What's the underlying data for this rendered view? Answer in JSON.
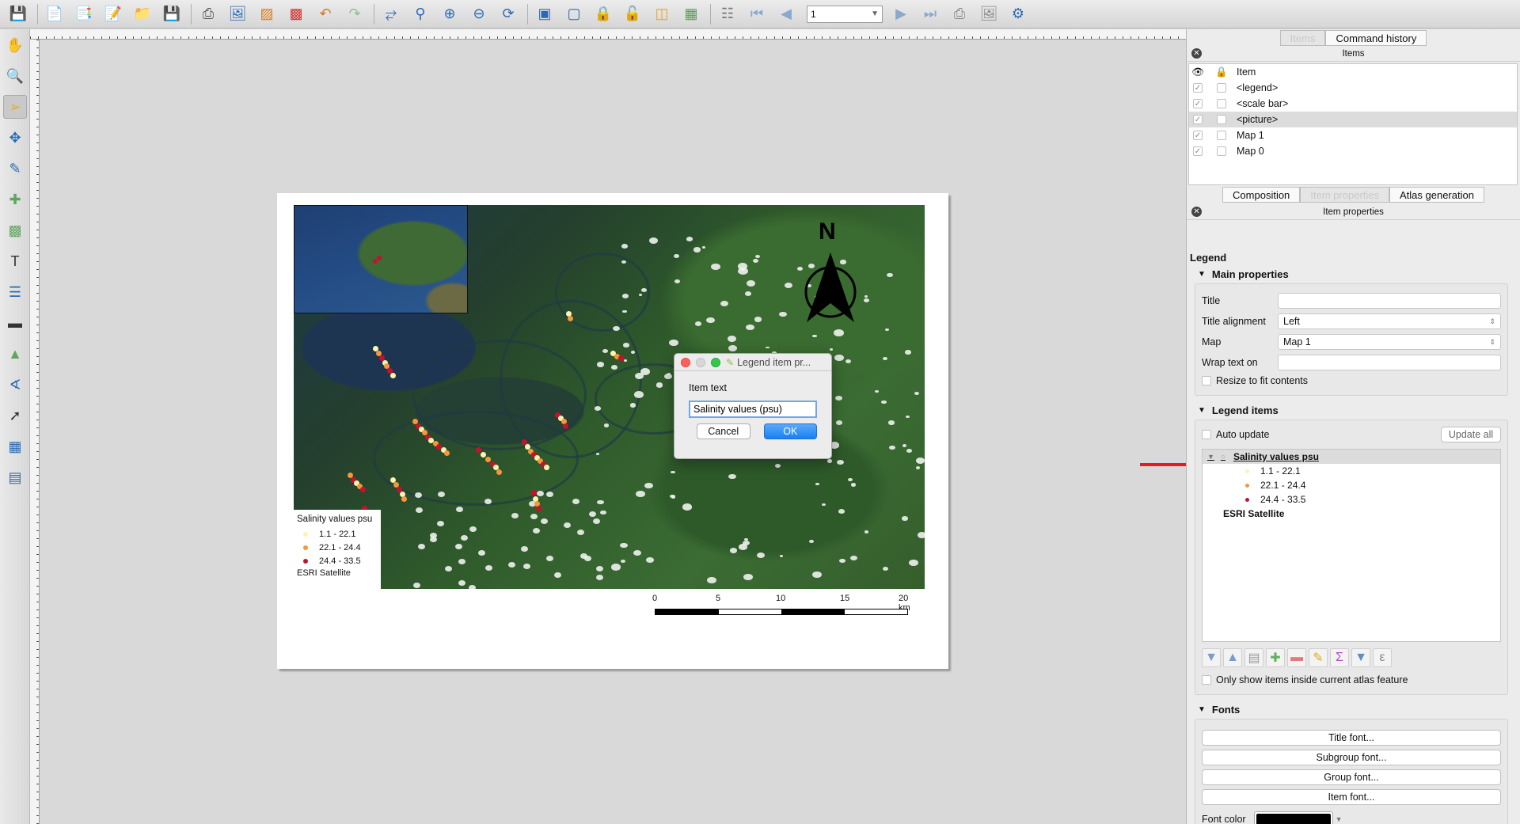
{
  "toolbar": {
    "icons": [
      "save-icon",
      "new-composer-icon",
      "duplicate-composer-icon",
      "composer-manager-icon",
      "open-template-icon",
      "save-template-icon",
      "print-icon",
      "export-image-icon",
      "export-svg-icon",
      "export-pdf-icon",
      "undo-icon",
      "redo-icon",
      "zoom-full-icon",
      "zoom-100-icon",
      "zoom-in-icon",
      "zoom-out-icon",
      "refresh-icon",
      "select-all-icon",
      "deselect-icon",
      "lock-icon",
      "unlock-icon",
      "raise-icon",
      "align-icon",
      "atlas-preview-icon",
      "first-feature-icon",
      "previous-feature-icon",
      "next-feature-icon",
      "last-feature-icon",
      "print-atlas-icon",
      "export-atlas-icon",
      "atlas-settings-icon"
    ],
    "page_value": "1"
  },
  "left_tools": [
    "pan-icon",
    "zoom-tool-icon",
    "select-move-icon",
    "move-content-icon",
    "edit-nodes-icon",
    "add-map-icon",
    "add-image-icon",
    "add-label-icon",
    "add-legend-icon",
    "add-scalebar-icon",
    "add-shape-icon",
    "add-node-item-icon",
    "add-arrow-icon",
    "add-table-icon",
    "add-html-icon"
  ],
  "map": {
    "north_letter": "N",
    "legend": {
      "title": "Salinity values psu",
      "items": [
        {
          "label": "1.1 - 22.1",
          "color": "#fff3b0"
        },
        {
          "label": "22.1 - 24.4",
          "color": "#f7963a"
        },
        {
          "label": "24.4 - 33.5",
          "color": "#c8102e"
        }
      ],
      "basemap": "ESRI Satellite"
    },
    "scalebar": {
      "labels": [
        "0",
        "5",
        "10",
        "15",
        "20 km"
      ]
    }
  },
  "dialog": {
    "title": "Legend item pr...",
    "label": "Item text",
    "input_value": "Salinity values (psu)",
    "cancel": "Cancel",
    "ok": "OK"
  },
  "right_panel": {
    "top_tabs": [
      "Items",
      "Command history"
    ],
    "items_title": "Items",
    "items_header": "Item",
    "items": [
      {
        "name": "<legend>",
        "selected": false
      },
      {
        "name": "<scale bar>",
        "selected": false
      },
      {
        "name": "<picture>",
        "selected": true
      },
      {
        "name": "Map 1",
        "selected": false
      },
      {
        "name": "Map 0",
        "selected": false
      }
    ],
    "mid_tabs": [
      "Composition",
      "Item properties",
      "Atlas generation"
    ],
    "props_title": "Item properties",
    "props_heading": "Legend",
    "main_properties": {
      "heading": "Main properties",
      "title_label": "Title",
      "title_value": "",
      "alignment_label": "Title alignment",
      "alignment_value": "Left",
      "map_label": "Map",
      "map_value": "Map 1",
      "wrap_label": "Wrap text on",
      "wrap_value": "",
      "resize_label": "Resize to fit contents"
    },
    "legend_items": {
      "heading": "Legend items",
      "auto_update": "Auto update",
      "update_all": "Update all",
      "tree_group": "Salinity values psu",
      "tree_items": [
        {
          "label": "1.1 - 22.1",
          "color": "#fff3b0"
        },
        {
          "label": "22.1 - 24.4",
          "color": "#f7963a"
        },
        {
          "label": "24.4 - 33.5",
          "color": "#c8102e"
        }
      ],
      "tree_basemap": "ESRI Satellite",
      "only_show": "Only show items inside current atlas feature"
    },
    "fonts": {
      "heading": "Fonts",
      "title_font": "Title font...",
      "subgroup_font": "Subgroup font...",
      "group_font": "Group font...",
      "item_font": "Item font...",
      "font_color_label": "Font color",
      "font_color": "#000000"
    }
  }
}
